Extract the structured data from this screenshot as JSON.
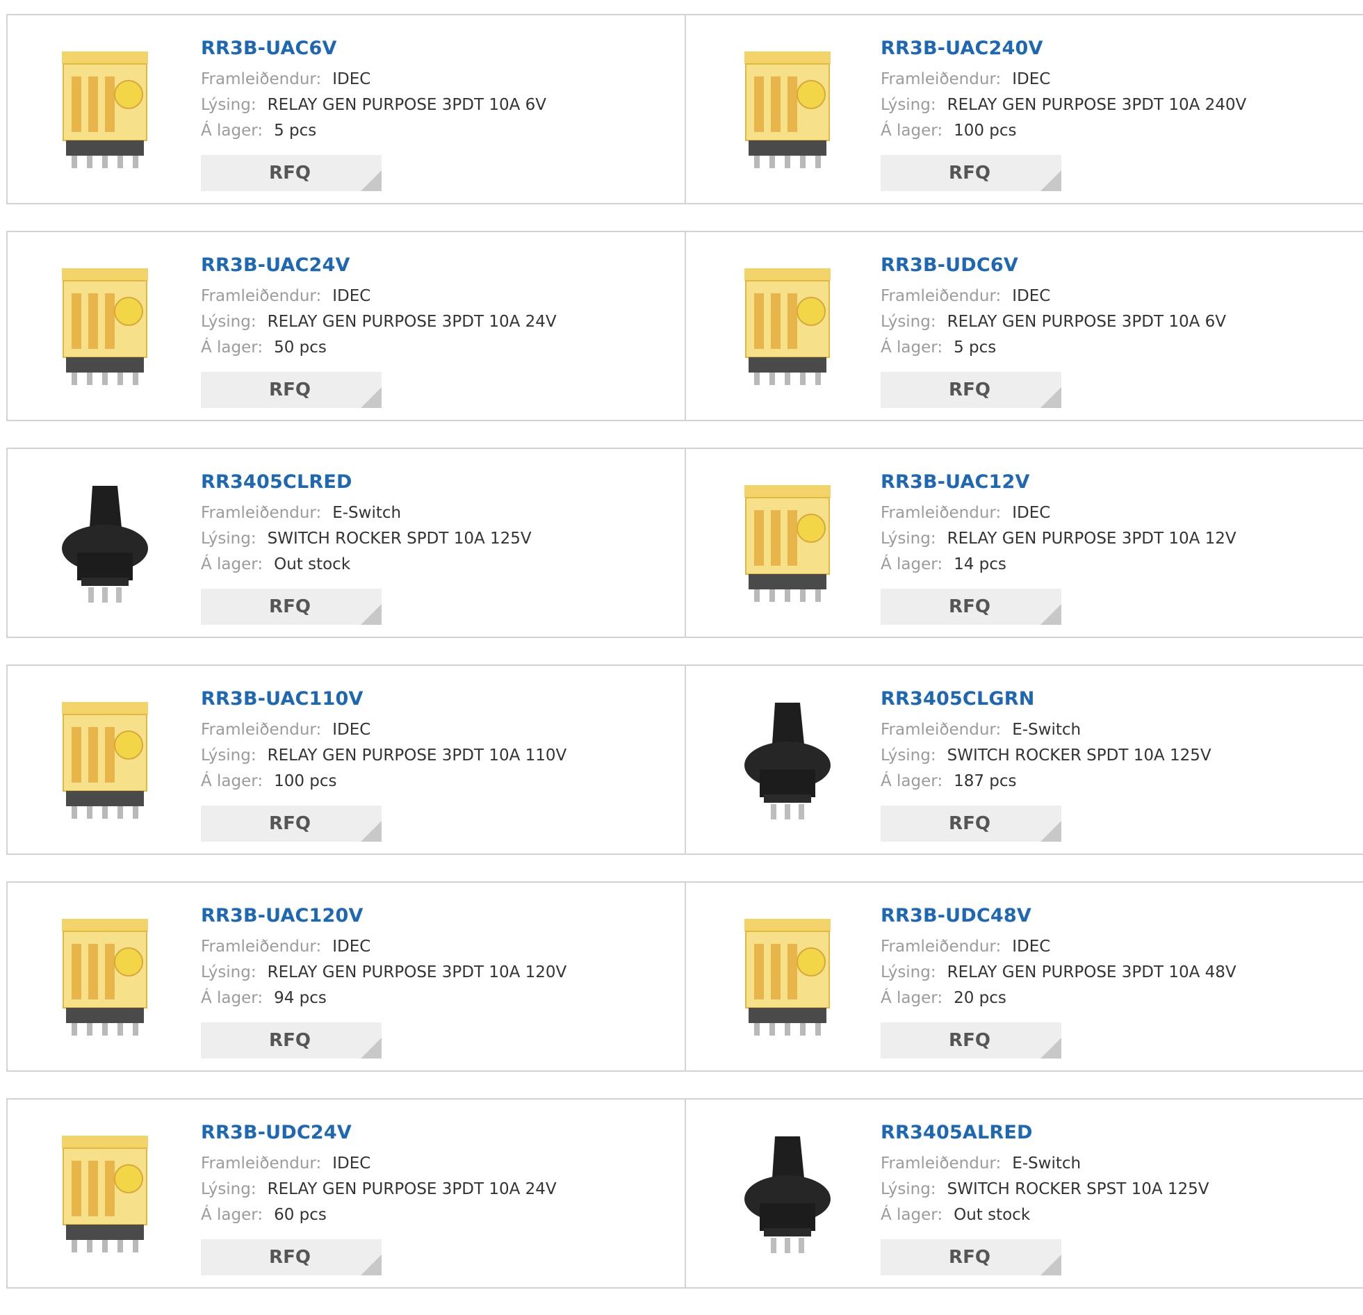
{
  "labels": {
    "manufacturer": "Framleiðendur:",
    "description": "Lýsing:",
    "stock": "Á lager:",
    "rfq": "RFQ"
  },
  "rows": [
    [
      {
        "part": "RR3B-UAC6V",
        "manufacturer": "IDEC",
        "description": "RELAY GEN PURPOSE 3PDT 10A 6V",
        "stock": "5 pcs",
        "image": "relay-icon"
      },
      {
        "part": "RR3B-UAC240V",
        "manufacturer": "IDEC",
        "description": "RELAY GEN PURPOSE 3PDT 10A 240V",
        "stock": "100 pcs",
        "image": "relay-icon"
      }
    ],
    [
      {
        "part": "RR3B-UAC24V",
        "manufacturer": "IDEC",
        "description": "RELAY GEN PURPOSE 3PDT 10A 24V",
        "stock": "50 pcs",
        "image": "relay-icon"
      },
      {
        "part": "RR3B-UDC6V",
        "manufacturer": "IDEC",
        "description": "RELAY GEN PURPOSE 3PDT 10A 6V",
        "stock": "5 pcs",
        "image": "relay-icon"
      }
    ],
    [
      {
        "part": "RR3405CLRED",
        "manufacturer": "E-Switch",
        "description": "SWITCH ROCKER SPDT 10A 125V",
        "stock": "Out stock",
        "image": "rocker-switch-icon"
      },
      {
        "part": "RR3B-UAC12V",
        "manufacturer": "IDEC",
        "description": "RELAY GEN PURPOSE 3PDT 10A 12V",
        "stock": "14 pcs",
        "image": "relay-icon"
      }
    ],
    [
      {
        "part": "RR3B-UAC110V",
        "manufacturer": "IDEC",
        "description": "RELAY GEN PURPOSE 3PDT 10A 110V",
        "stock": "100 pcs",
        "image": "relay-icon"
      },
      {
        "part": "RR3405CLGRN",
        "manufacturer": "E-Switch",
        "description": "SWITCH ROCKER SPDT 10A 125V",
        "stock": "187 pcs",
        "image": "rocker-switch-icon"
      }
    ],
    [
      {
        "part": "RR3B-UAC120V",
        "manufacturer": "IDEC",
        "description": "RELAY GEN PURPOSE 3PDT 10A 120V",
        "stock": "94 pcs",
        "image": "relay-icon"
      },
      {
        "part": "RR3B-UDC48V",
        "manufacturer": "IDEC",
        "description": "RELAY GEN PURPOSE 3PDT 10A 48V",
        "stock": "20 pcs",
        "image": "relay-icon"
      }
    ],
    [
      {
        "part": "RR3B-UDC24V",
        "manufacturer": "IDEC",
        "description": "RELAY GEN PURPOSE 3PDT 10A 24V",
        "stock": "60 pcs",
        "image": "relay-icon"
      },
      {
        "part": "RR3405ALRED",
        "manufacturer": "E-Switch",
        "description": "SWITCH ROCKER SPST 10A 125V",
        "stock": "Out stock",
        "image": "rocker-switch-icon"
      }
    ]
  ],
  "colors": {
    "part_link": "#1d67b3",
    "label": "#9b9b9b",
    "value": "#333333",
    "rfq_bg": "#eeeeee",
    "border": "#d3d3d3"
  }
}
